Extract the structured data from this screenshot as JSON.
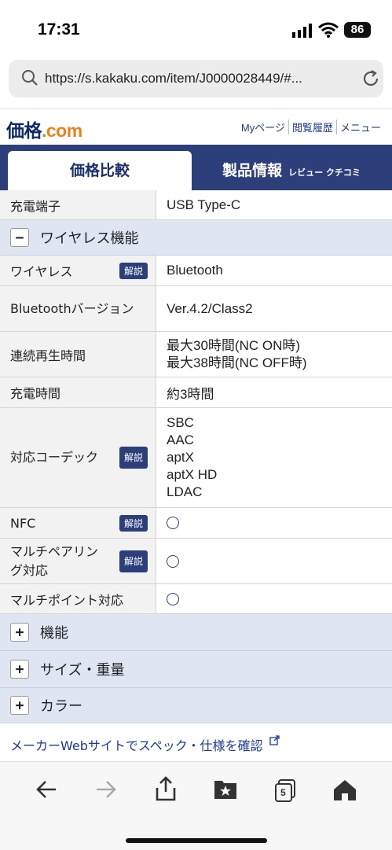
{
  "status": {
    "time": "17:31",
    "battery": "86"
  },
  "browser": {
    "url": "https://s.kakaku.com/item/J0000028449/#..."
  },
  "site": {
    "logo_main": "価格",
    "logo_dot": ".com",
    "nav": [
      "Myページ",
      "閲覧履歴",
      "メニュー"
    ]
  },
  "tabs": {
    "price": "価格比較",
    "info": "製品情報",
    "info_sub": "レビュー クチコミ"
  },
  "specs": {
    "charge_port": {
      "label": "充電端子",
      "value": "USB Type-C"
    },
    "wireless_section": "ワイヤレス機能",
    "explain_badge": "解説",
    "wireless": {
      "label": "ワイヤレス",
      "value": "Bluetooth"
    },
    "bt_version": {
      "label": "Bluetoothバージョン",
      "value": "Ver.4.2/Class2"
    },
    "playtime": {
      "label": "連続再生時間",
      "value1": "最大30時間(NC ON時)",
      "value2": "最大38時間(NC OFF時)"
    },
    "charge_time": {
      "label": "充電時間",
      "value": "約3時間"
    },
    "codec": {
      "label": "対応コーデック",
      "values": [
        "SBC",
        "AAC",
        "aptX",
        "aptX HD",
        "LDAC"
      ]
    },
    "nfc": {
      "label": "NFC"
    },
    "multipairing": {
      "label": "マルチペアリング対応"
    },
    "multipoint": {
      "label": "マルチポイント対応"
    },
    "sections_collapsed": [
      "機能",
      "サイズ・重量",
      "カラー"
    ]
  },
  "maker_link": "メーカーWebサイトでスペック・仕様を確認",
  "toolbar": {
    "tabs_count": "5"
  }
}
